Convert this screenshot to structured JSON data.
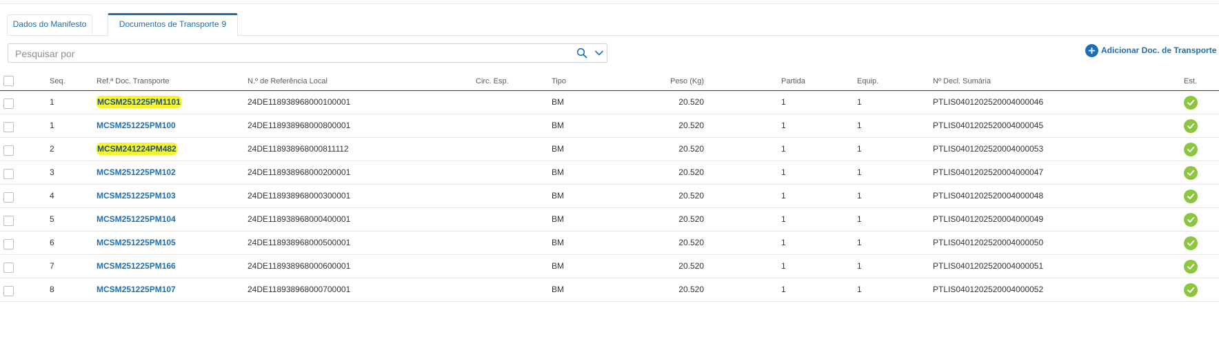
{
  "tabs": [
    {
      "label": "Dados do Manifesto",
      "count": ""
    },
    {
      "label": "Documentos de Transporte",
      "count": "9"
    }
  ],
  "search": {
    "placeholder": "Pesquisar por"
  },
  "add_button": {
    "label": "Adicionar Doc. de Transporte"
  },
  "table": {
    "headers": {
      "seq": "Seq.",
      "ref": "Ref.ª Doc. Transporte",
      "nref": "N.º de Referência Local",
      "circ": "Circ. Esp.",
      "tipo": "Tipo",
      "peso": "Peso (Kg)",
      "partida": "Partida",
      "equip": "Equip.",
      "decl": "Nº Decl. Sumária",
      "est": "Est."
    },
    "rows": [
      {
        "seq": "1",
        "ref": "MCSM251225PM1101",
        "nref": "24DE118938968000100001",
        "circ": "",
        "tipo": "BM",
        "peso": "20.520",
        "partida": "1",
        "equip": "1",
        "decl": "PTLIS0401202520004000046",
        "highlighted": true
      },
      {
        "seq": "1",
        "ref": "MCSM251225PM100",
        "nref": "24DE118938968000800001",
        "circ": "",
        "tipo": "BM",
        "peso": "20.520",
        "partida": "1",
        "equip": "1",
        "decl": "PTLIS0401202520004000045",
        "highlighted": false
      },
      {
        "seq": "2",
        "ref": "MCSM241224PM482",
        "nref": "24DE118938968000811112",
        "circ": "",
        "tipo": "BM",
        "peso": "20.520",
        "partida": "1",
        "equip": "1",
        "decl": "PTLIS0401202520004000053",
        "highlighted": true
      },
      {
        "seq": "3",
        "ref": "MCSM251225PM102",
        "nref": "24DE118938968000200001",
        "circ": "",
        "tipo": "BM",
        "peso": "20.520",
        "partida": "1",
        "equip": "1",
        "decl": "PTLIS0401202520004000047",
        "highlighted": false
      },
      {
        "seq": "4",
        "ref": "MCSM251225PM103",
        "nref": "24DE118938968000300001",
        "circ": "",
        "tipo": "BM",
        "peso": "20.520",
        "partida": "1",
        "equip": "1",
        "decl": "PTLIS0401202520004000048",
        "highlighted": false
      },
      {
        "seq": "5",
        "ref": "MCSM251225PM104",
        "nref": "24DE118938968000400001",
        "circ": "",
        "tipo": "BM",
        "peso": "20.520",
        "partida": "1",
        "equip": "1",
        "decl": "PTLIS0401202520004000049",
        "highlighted": false
      },
      {
        "seq": "6",
        "ref": "MCSM251225PM105",
        "nref": "24DE118938968000500001",
        "circ": "",
        "tipo": "BM",
        "peso": "20.520",
        "partida": "1",
        "equip": "1",
        "decl": "PTLIS0401202520004000050",
        "highlighted": false
      },
      {
        "seq": "7",
        "ref": "MCSM251225PM166",
        "nref": "24DE118938968000600001",
        "circ": "",
        "tipo": "BM",
        "peso": "20.520",
        "partida": "1",
        "equip": "1",
        "decl": "PTLIS0401202520004000051",
        "highlighted": false
      },
      {
        "seq": "8",
        "ref": "MCSM251225PM107",
        "nref": "24DE118938968000700001",
        "circ": "",
        "tipo": "BM",
        "peso": "20.520",
        "partida": "1",
        "equip": "1",
        "decl": "PTLIS0401202520004000052",
        "highlighted": false
      }
    ]
  },
  "colors": {
    "accent": "#1e6fb2",
    "highlight": "#f7f42b",
    "status_ok": "#8cc63f"
  },
  "icons": {
    "search": "search-icon",
    "dropdown": "chevron-down-icon",
    "add": "plus-circle-icon",
    "status": "check-circle-icon"
  }
}
